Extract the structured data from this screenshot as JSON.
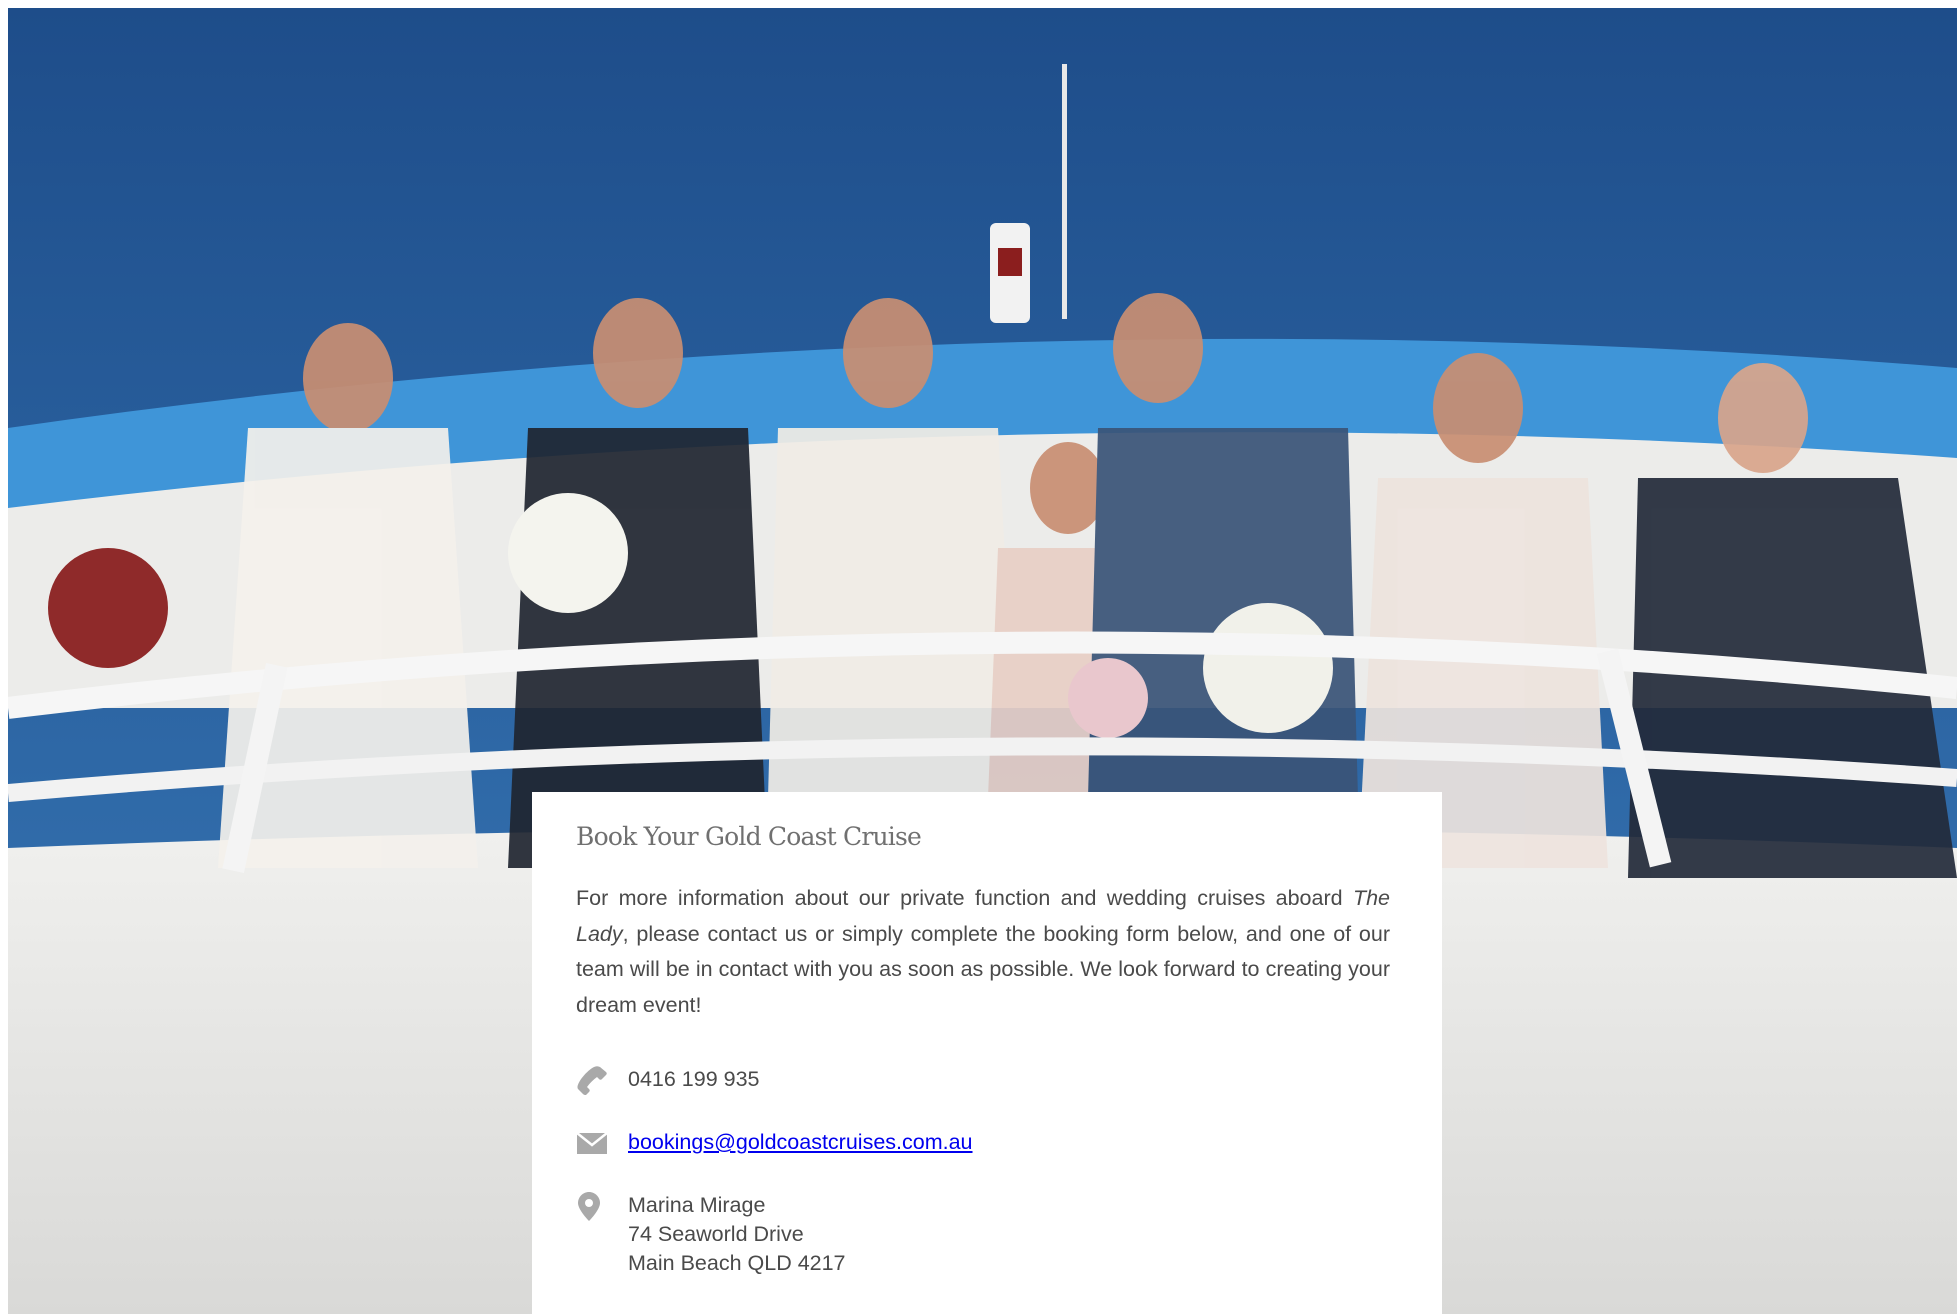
{
  "hero": {
    "image_alt": "Wedding party standing at the railing on the top deck of a white cruise boat under a clear blue sky"
  },
  "card": {
    "title": "Book Your Gold Coast Cruise",
    "intro_before": "For more information about our private function and wedding cruises aboard ",
    "intro_vessel": "The Lady",
    "intro_after": ", please contact us or simply complete the booking form below, and one of our team will be in contact with you as soon as possible. We look forward to creating your dream event!"
  },
  "contact": {
    "phone": "0416 199 935",
    "email": "bookings@goldcoastcruises.com.au",
    "address": {
      "line1": "Marina Mirage",
      "line2": "74 Seaworld Drive",
      "line3": "Main Beach QLD 4217"
    }
  },
  "colors": {
    "sky": "#2a5f9e",
    "roof": "#3f95d8",
    "hull": "#e2e2e0",
    "icon": "#a9a9a9",
    "text": "#4a4a4a",
    "title": "#707070"
  },
  "icons": {
    "phone": "phone-icon",
    "email": "envelope-icon",
    "address": "map-pin-icon"
  }
}
